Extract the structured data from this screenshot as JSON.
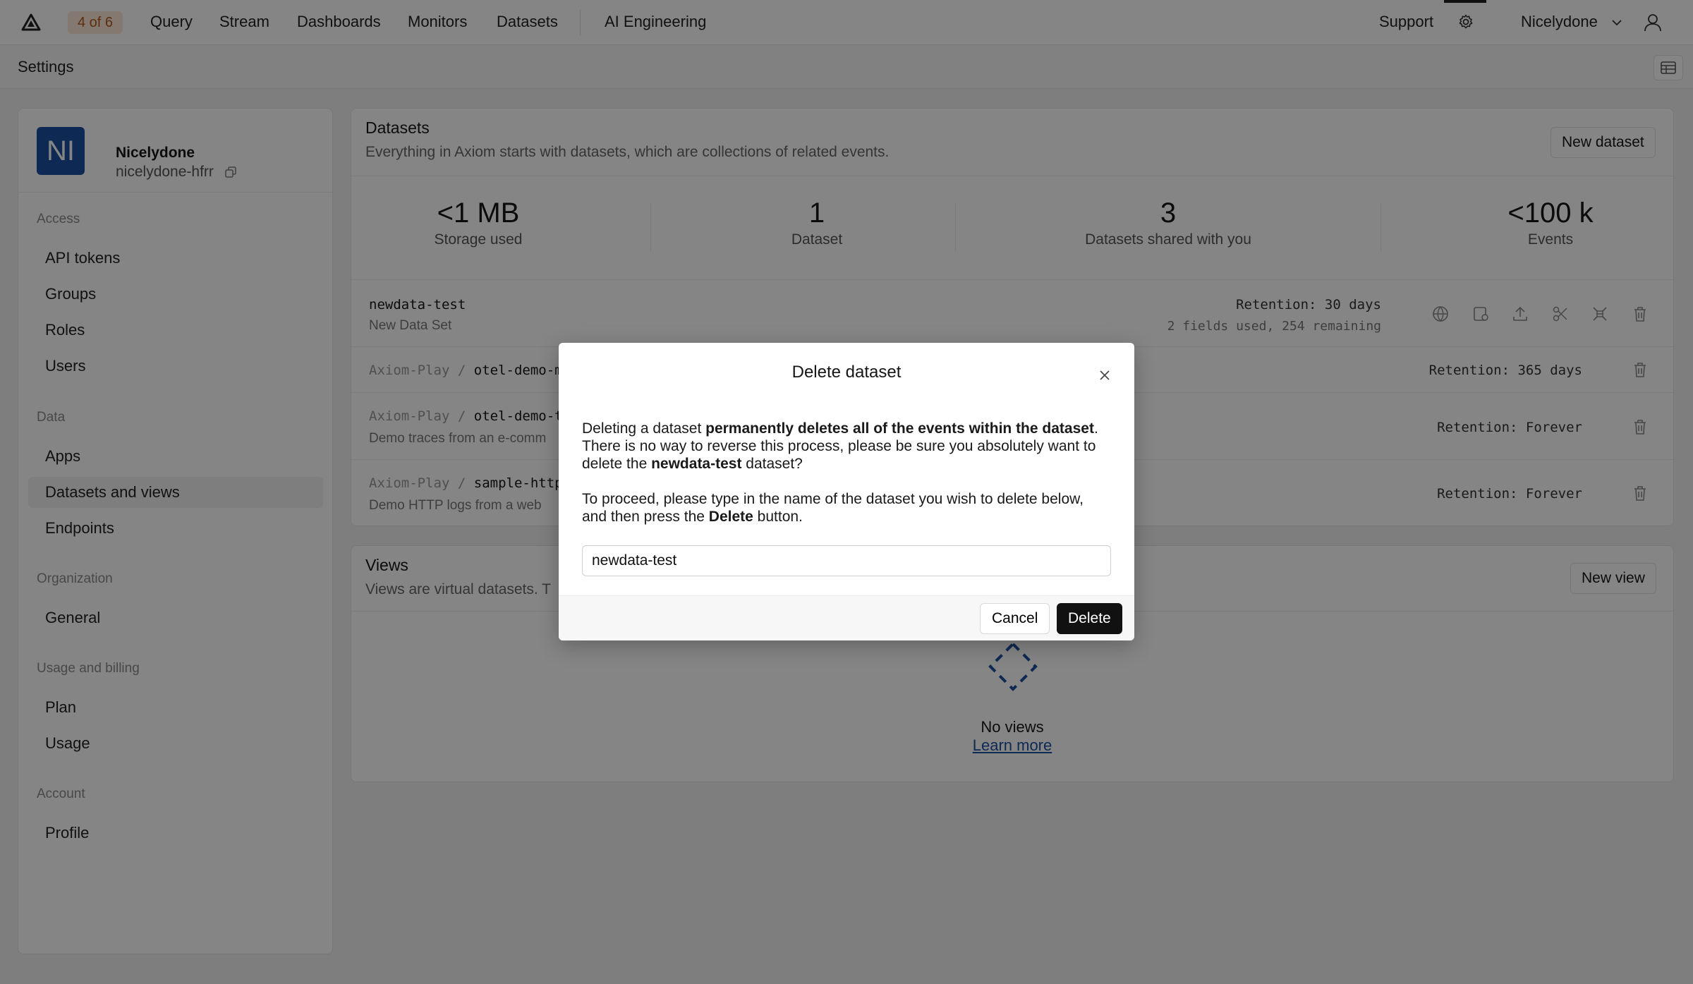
{
  "topbar": {
    "badge": "4 of 6",
    "nav": [
      "Query",
      "Stream",
      "Dashboards",
      "Monitors",
      "Datasets",
      "AI Engineering"
    ],
    "support": "Support",
    "user": "Nicelydone"
  },
  "subhead": {
    "title": "Settings"
  },
  "sidebar": {
    "org_initials": "NI",
    "org_name": "Nicelydone",
    "org_slug": "nicelydone-hfrr",
    "sections": [
      {
        "label": "Access",
        "items": [
          "API tokens",
          "Groups",
          "Roles",
          "Users"
        ]
      },
      {
        "label": "Data",
        "items": [
          "Apps",
          "Datasets and views",
          "Endpoints"
        ]
      },
      {
        "label": "Organization",
        "items": [
          "General"
        ]
      },
      {
        "label": "Usage and billing",
        "items": [
          "Plan",
          "Usage"
        ]
      },
      {
        "label": "Account",
        "items": [
          "Profile"
        ]
      }
    ],
    "active_item": "Datasets and views"
  },
  "datasets": {
    "title": "Datasets",
    "description": "Everything in Axiom starts with datasets, which are collections of related events.",
    "new_button": "New dataset",
    "stats": [
      {
        "value": "<1 MB",
        "label": "Storage used"
      },
      {
        "value": "1",
        "label": "Dataset"
      },
      {
        "value": "3",
        "label": "Datasets shared with you"
      },
      {
        "value": "<100 k",
        "label": "Events"
      }
    ],
    "rows": [
      {
        "org": "",
        "name": "newdata-test",
        "desc": "New Data Set",
        "retention": "Retention: 30 days",
        "fields": "2 fields used, 254 remaining"
      },
      {
        "org": "Axiom-Play",
        "name": "otel-demo-m",
        "desc": "",
        "retention": "Retention: 365 days",
        "fields": ""
      },
      {
        "org": "Axiom-Play",
        "name": "otel-demo-t",
        "desc": "Demo traces from an e-comm",
        "retention": "Retention: Forever",
        "fields": ""
      },
      {
        "org": "Axiom-Play",
        "name": "sample-http",
        "desc": "Demo HTTP logs from a web",
        "retention": "Retention: Forever",
        "fields": ""
      }
    ],
    "org_separator": "/"
  },
  "views": {
    "title": "Views",
    "description": "Views are virtual datasets. T",
    "new_button": "New view",
    "empty_title": "No views",
    "learn_more": "Learn more"
  },
  "modal": {
    "title": "Delete dataset",
    "p1_a": "Deleting a dataset ",
    "p1_b": "permanently deletes all of the events within the dataset",
    "p1_c": ". There is no way to reverse this process, please be sure you absolutely want to delete the ",
    "p1_d": "newdata-test",
    "p1_e": " dataset?",
    "p2_a": "To proceed, please type in the name of the dataset you wish to delete below, and then press the ",
    "p2_b": "Delete",
    "p2_c": " button.",
    "input_value": "newdata-test",
    "cancel": "Cancel",
    "delete": "Delete"
  }
}
